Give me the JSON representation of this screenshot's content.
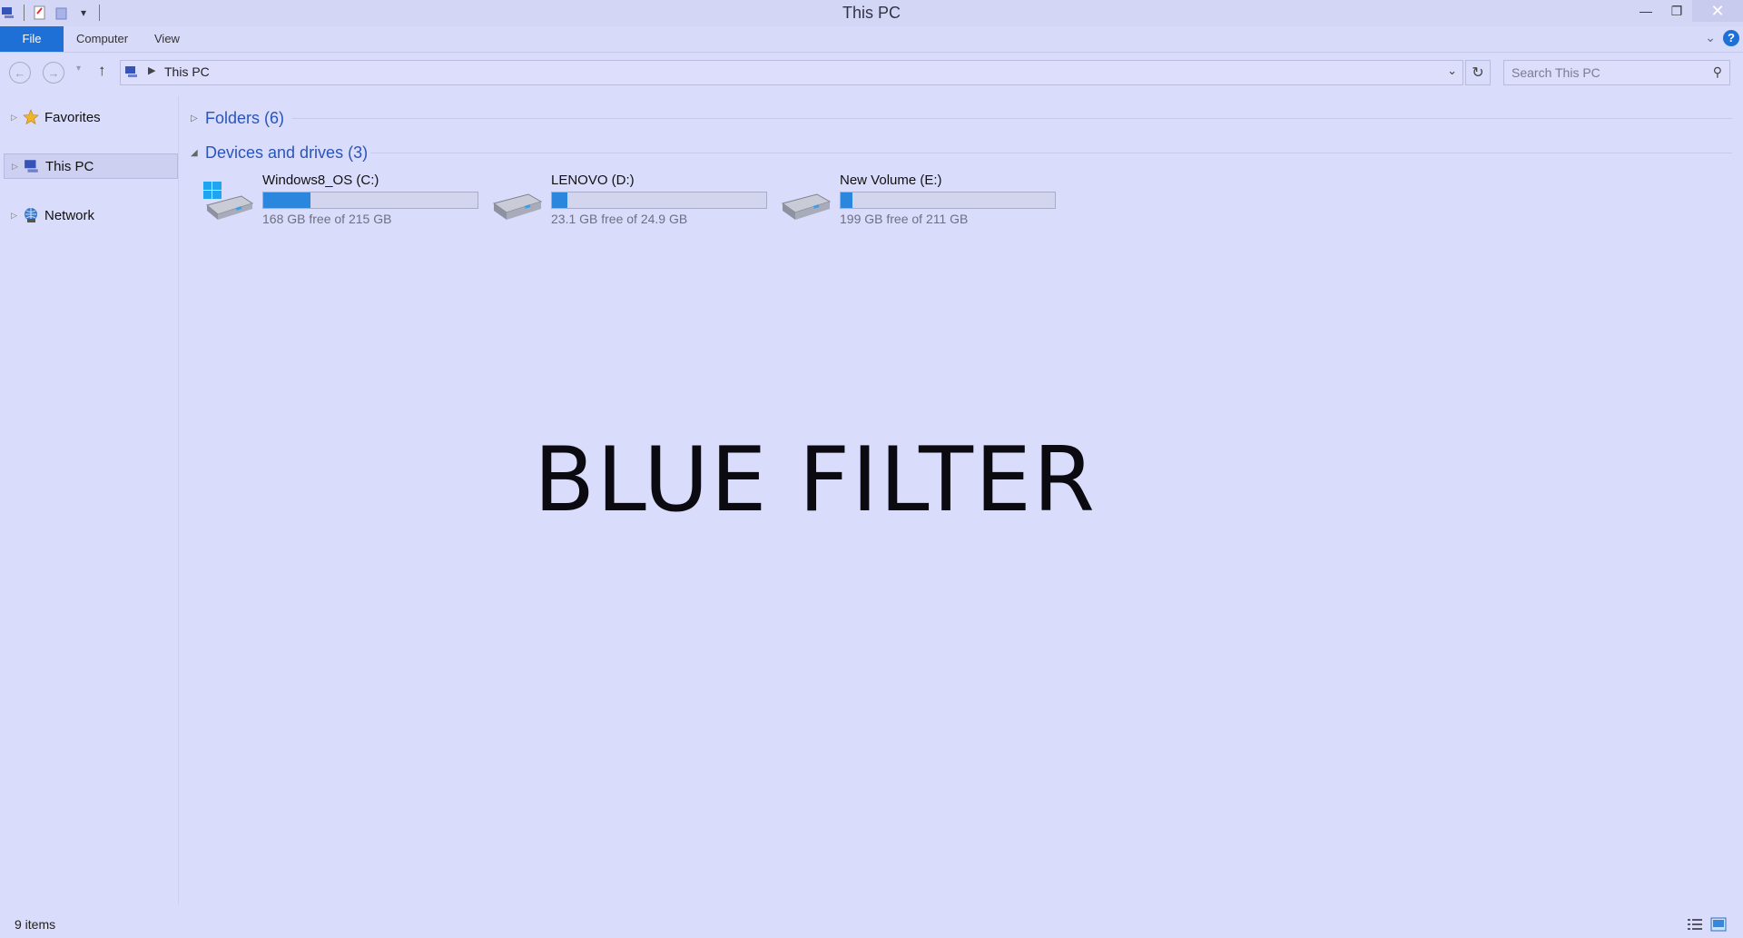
{
  "window": {
    "title": "This PC",
    "buttons": {
      "minimize": "—",
      "maximize": "❐",
      "close": "✕"
    }
  },
  "ribbon": {
    "tabs": [
      "File",
      "Computer",
      "View"
    ],
    "accent": "#1e6fd6",
    "help": "?"
  },
  "address": {
    "breadcrumb": "This PC",
    "search_placeholder": "Search This PC"
  },
  "nav_pane": {
    "items": [
      {
        "label": "Favorites",
        "icon": "star-icon"
      },
      {
        "label": "This PC",
        "icon": "computer-icon",
        "selected": true
      },
      {
        "label": "Network",
        "icon": "network-icon"
      }
    ]
  },
  "content": {
    "groups": [
      {
        "label": "Folders (6)",
        "expanded": false
      },
      {
        "label": "Devices and drives (3)",
        "expanded": true
      }
    ],
    "drives": [
      {
        "name": "Windows8_OS (C:)",
        "free_text": "168 GB free of 215 GB",
        "used_fraction": 0.219,
        "icon": "windows-drive-icon"
      },
      {
        "name": "LENOVO (D:)",
        "free_text": "23.1 GB free of 24.9 GB",
        "used_fraction": 0.072,
        "icon": "drive-icon"
      },
      {
        "name": "New Volume (E:)",
        "free_text": "199 GB free of 211 GB",
        "used_fraction": 0.057,
        "icon": "drive-icon"
      }
    ],
    "bar_color": "#2b86dd",
    "overlay_text": "BLUE FILTER"
  },
  "status": {
    "item_count": "9 items"
  }
}
